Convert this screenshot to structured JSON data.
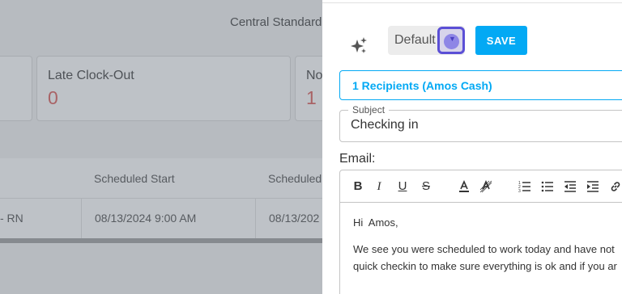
{
  "background": {
    "timezone": "Central Standard",
    "cards": [
      {
        "label": "",
        "value": ""
      },
      {
        "label": "Late Clock-Out",
        "value": "0"
      },
      {
        "label": "No",
        "value": "1"
      }
    ],
    "table": {
      "headers": [
        "Scheduled Start",
        "Scheduled"
      ],
      "row": [
        "- RN",
        "08/13/2024 9:00 AM",
        "08/13/202"
      ]
    }
  },
  "panel": {
    "template_select": {
      "value": "Default"
    },
    "save_label": "SAVE",
    "recipients_label": "1 Recipients (Amos Cash)",
    "subject": {
      "legend": "Subject",
      "value": "Checking in"
    },
    "email_label": "Email:",
    "toolbar": [
      "bold",
      "italic",
      "underline",
      "strikethrough",
      "font-color",
      "clear-format",
      "ordered-list",
      "bullet-list",
      "outdent",
      "indent",
      "link"
    ],
    "email_body": {
      "greeting": "Hi  Amos,",
      "line1": "We see you were scheduled to work today and have not",
      "line2": "quick checkin to make sure everything is ok and if you ar"
    }
  },
  "colors": {
    "accent": "#03a9f4",
    "alert": "#d9534f",
    "focus": "#5b4fd6"
  }
}
